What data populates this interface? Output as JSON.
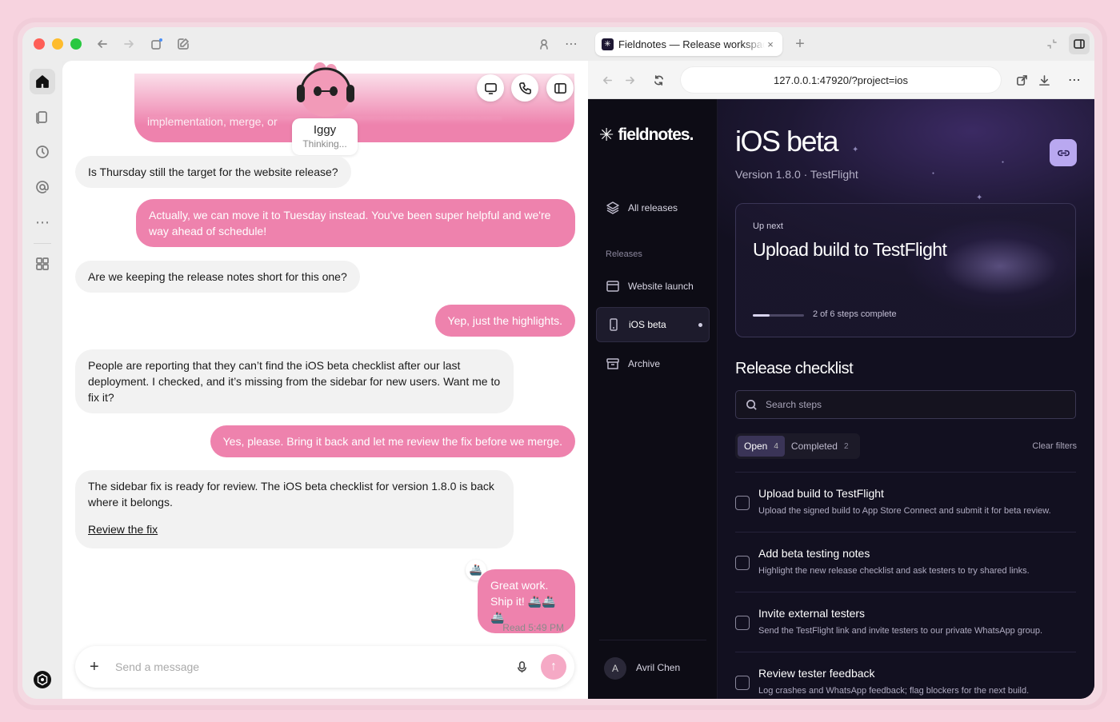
{
  "toolbar": {
    "colors": {
      "close": "#fe5f57",
      "minimize": "#febc2e",
      "maximize": "#28c840"
    }
  },
  "tab": {
    "title": "Fieldnotes — Release workspace",
    "close": "×",
    "new": "+"
  },
  "chat": {
    "top_preview": "implementation, merge, or",
    "agent": {
      "name": "Iggy",
      "status": "Thinking..."
    },
    "messages": [
      {
        "from": "user",
        "text": "Is Thursday still the target for the website release?"
      },
      {
        "from": "me",
        "text": "Actually, we can move it to Tuesday instead. You've been super helpful and we're way ahead of schedule!"
      },
      {
        "from": "user",
        "text": "Are we keeping the release notes short for this one?"
      },
      {
        "from": "me",
        "text": "Yep, just the highlights."
      },
      {
        "from": "user",
        "text": "People are reporting that they can’t find the iOS beta checklist after our last deployment. I checked, and it’s missing from the sidebar for new users. Want me to fix it?"
      },
      {
        "from": "me",
        "text": "Yes, please. Bring it back and let me review the fix before we merge."
      },
      {
        "from": "user",
        "text": "The sidebar fix is ready for review. The iOS beta checklist for version 1.8.0 is back where it belongs.",
        "link": "Review the fix"
      },
      {
        "from": "me",
        "text": "Great work. Ship it! 🚢🚢🚢"
      }
    ],
    "reaction": "🚢",
    "read_receipt": "Read 5:49 PM",
    "composer_placeholder": "Send a message"
  },
  "browser": {
    "url": "127.0.0.1:47920/?project=ios",
    "site": {
      "logo": "fieldnotes.",
      "logo_mark": "✳",
      "nav": {
        "all_releases": "All releases",
        "releases_caption": "Releases",
        "items": [
          "Website launch",
          "iOS beta",
          "Archive"
        ]
      },
      "user": {
        "initial": "A",
        "name": "Avril Chen"
      },
      "title": "iOS beta",
      "version": "Version 1.8.0 · TestFlight",
      "up_next": {
        "label": "Up next",
        "title": "Upload build to TestFlight",
        "progress": 0.333,
        "steps": "2 of 6 steps complete"
      },
      "checklist": {
        "heading": "Release checklist",
        "search_placeholder": "Search steps",
        "tabs": [
          {
            "label": "Open",
            "count": "4"
          },
          {
            "label": "Completed",
            "count": "2"
          }
        ],
        "clear": "Clear filters",
        "tasks": [
          {
            "title": "Upload build to TestFlight",
            "desc": "Upload the signed build to App Store Connect and submit it for beta review."
          },
          {
            "title": "Add beta testing notes",
            "desc": "Highlight the new release checklist and ask testers to try shared links."
          },
          {
            "title": "Invite external testers",
            "desc": "Send the TestFlight link and invite testers to our private WhatsApp group."
          },
          {
            "title": "Review tester feedback",
            "desc": "Log crashes and WhatsApp feedback; flag blockers for the next build."
          }
        ]
      }
    }
  }
}
